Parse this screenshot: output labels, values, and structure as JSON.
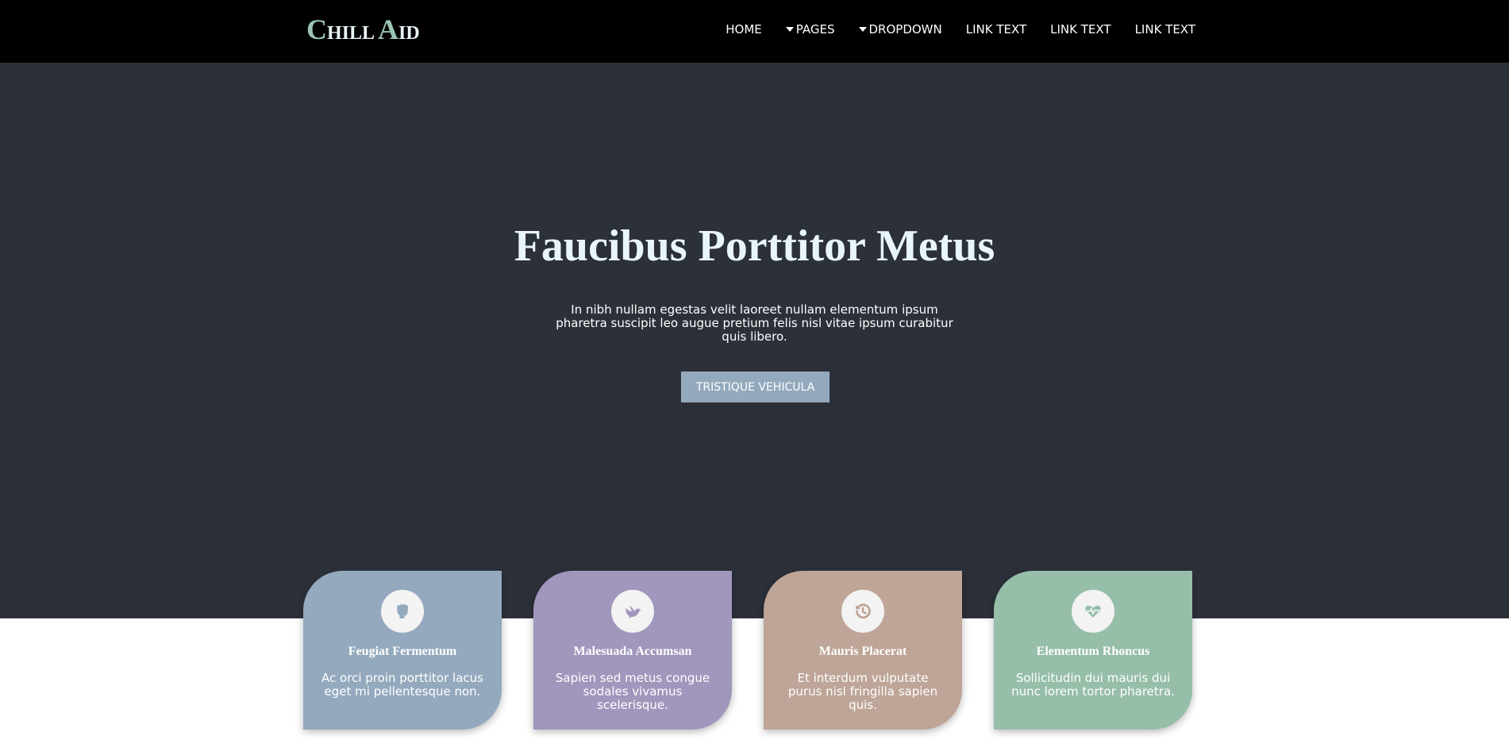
{
  "brand": {
    "logo_c": "C",
    "logo_hill": "HILL",
    "logo_a": "A",
    "logo_id": "ID"
  },
  "nav": {
    "items": [
      {
        "label": "HOME"
      },
      {
        "label": "PAGES"
      },
      {
        "label": "DROPDOWN"
      },
      {
        "label": "LINK TEXT"
      },
      {
        "label": "LINK TEXT"
      },
      {
        "label": "LINK TEXT"
      }
    ]
  },
  "hero": {
    "title": "Faucibus Porttitor Metus",
    "subtitle": "In nibh nullam egestas velit laoreet nullam elementum ipsum pharetra suscipit leo augue pretium felis nisl vitae ipsum curabitur quis libero.",
    "button_label": "TRISTIQUE VEHICULA"
  },
  "features": [
    {
      "title": "Feugiat Fermentum",
      "text": "Ac orci proin porttitor lacus eget mi pellentesque non.",
      "icon": "fist-icon",
      "color": "#94a9bd"
    },
    {
      "title": "Malesuada Accumsan",
      "text": "Sapien sed metus congue sodales vivamus scelerisque.",
      "icon": "dove-icon",
      "color": "#a196bc"
    },
    {
      "title": "Mauris Placerat",
      "text": "Et interdum vulputate purus nisl fringilla sapien quis.",
      "icon": "history-icon",
      "color": "#bea597"
    },
    {
      "title": "Elementum Rhoncus",
      "text": "Sollicitudin dui mauris dui nunc lorem tortor pharetra.",
      "icon": "heartbeat-icon",
      "color": "#96bea9"
    }
  ],
  "colors": {
    "topbar": "#000000",
    "hero_bg": "#2c3039",
    "heading": "#e9f6f9",
    "logo_accent": "#9bc5b2",
    "button": "#94a9bd"
  }
}
